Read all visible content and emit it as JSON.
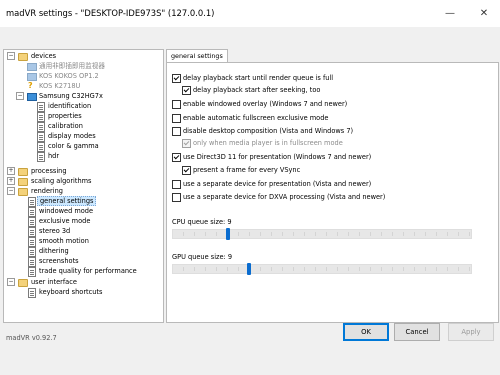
{
  "window": {
    "title": "madVR settings - \"DESKTOP-IDE973S\" (127.0.0.1)",
    "controls": {
      "minimize": "—",
      "close": "✕"
    }
  },
  "tree": {
    "devices": "devices",
    "device1": "通用非即插即用监视器",
    "device2": "KOS KOKOS OP1.2",
    "device3": "KOS K2718U",
    "device4": "Samsung C32HG7x",
    "device4_children": [
      "identification",
      "properties",
      "calibration",
      "display modes",
      "color & gamma",
      "hdr"
    ],
    "processing": "processing",
    "scaling": "scaling algorithms",
    "rendering": "rendering",
    "rendering_children": [
      "general settings",
      "windowed mode",
      "exclusive mode",
      "stereo 3d",
      "smooth motion",
      "dithering",
      "screenshots",
      "trade quality for performance"
    ],
    "user_interface": "user interface",
    "user_interface_children": [
      "keyboard shortcuts"
    ],
    "selected": "general settings"
  },
  "tab": {
    "label": "general settings"
  },
  "options": [
    {
      "label": "delay playback start until render queue is full",
      "checked": true,
      "disabled": false
    },
    {
      "label": "delay playback start after seeking, too",
      "checked": true,
      "disabled": false
    },
    {
      "label": "enable windowed overlay (Windows 7 and newer)",
      "checked": false,
      "disabled": false
    },
    {
      "label": "enable automatic fullscreen exclusive mode",
      "checked": false,
      "disabled": false
    },
    {
      "label": "disable desktop composition (Vista and Windows 7)",
      "checked": false,
      "disabled": false
    },
    {
      "label": "only when media player is in fullscreen mode",
      "checked": true,
      "disabled": true
    },
    {
      "label": "use Direct3D 11 for presentation (Windows 7 and newer)",
      "checked": true,
      "disabled": false
    },
    {
      "label": "present a frame for every VSync",
      "checked": true,
      "disabled": false
    },
    {
      "label": "use a separate device for presentation (Vista and newer)",
      "checked": false,
      "disabled": false
    },
    {
      "label": "use a separate device for DXVA processing (Vista and newer)",
      "checked": false,
      "disabled": false
    }
  ],
  "cpu_queue": {
    "label": "CPU queue size: 9",
    "value": 9,
    "min": 4,
    "max": 32
  },
  "gpu_queue": {
    "label": "GPU queue size: 9",
    "value": 9,
    "min": 4,
    "max": 24
  },
  "footer": {
    "version": "madVR v0.92.7",
    "ok": "OK",
    "cancel": "Cancel",
    "apply": "Apply"
  },
  "colors": {
    "accent": "#0078d7",
    "slider_thumb": "#0a6ccf",
    "selection": "#cce8ff"
  }
}
